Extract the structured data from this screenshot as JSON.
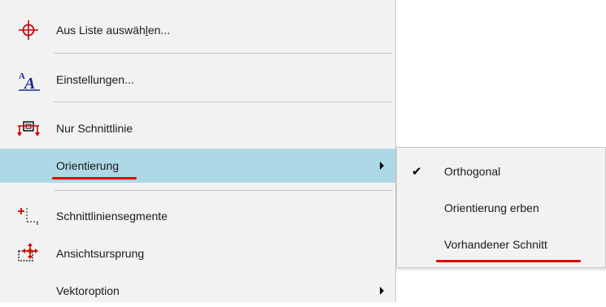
{
  "menu": {
    "items": [
      {
        "label_pre": "Aus Liste auswäh",
        "label_ul": "l",
        "label_post": "en...",
        "icon": "crosshair-icon"
      },
      {
        "label": "Einstellungen...",
        "icon": "font-settings-icon"
      },
      {
        "label": "Nur Schnittlinie",
        "icon": "section-line-icon"
      },
      {
        "label": "Orientierung",
        "icon": "",
        "highlighted": true,
        "has_submenu": true
      },
      {
        "label": "Schnittliniensegmente",
        "icon": "section-segments-icon"
      },
      {
        "label": "Ansichtsursprung",
        "icon": "view-origin-icon"
      },
      {
        "label": "Vektoroption",
        "icon": "",
        "has_submenu": true
      }
    ]
  },
  "submenu": {
    "items": [
      {
        "label": "Orthogonal",
        "checked": true,
        "check_glyph": "✔"
      },
      {
        "label": "Orientierung erben",
        "checked": false
      },
      {
        "label": "Vorhandener Schnitt",
        "checked": false
      }
    ]
  },
  "colors": {
    "highlight": "#add8e6",
    "annotation_red": "#e00000",
    "menu_bg": "#f2f2f2"
  }
}
